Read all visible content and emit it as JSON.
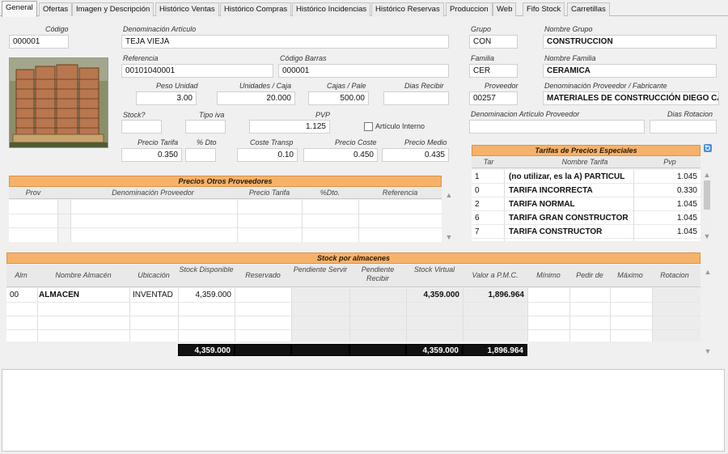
{
  "tabs": [
    "General",
    "Ofertas",
    "Imagen y Descripción",
    "Histórico Ventas",
    "Histórico Compras",
    "Histórico Incidencias",
    "Histórico Reservas",
    "Produccion",
    "Web",
    "Fifo Stock",
    "Carretillas"
  ],
  "fields": {
    "codigo": {
      "label": "Código",
      "value": "000001"
    },
    "denominacion": {
      "label": "Denominación Artículo",
      "value": "TEJA VIEJA"
    },
    "referencia": {
      "label": "Referencia",
      "value": "00101040001"
    },
    "codigo_barras": {
      "label": "Código Barras",
      "value": "000001"
    },
    "peso_unidad": {
      "label": "Peso Unidad",
      "value": "3.00"
    },
    "unidades_caja": {
      "label": "Unidades / Caja",
      "value": "20.000"
    },
    "cajas_pale": {
      "label": "Cajas / Pale",
      "value": "500.00"
    },
    "dias_recibir": {
      "label": "Dias Recibir",
      "value": ""
    },
    "stock": {
      "label": "Stock?",
      "value": ""
    },
    "tipo_iva": {
      "label": "Tipo iva",
      "value": ""
    },
    "pvp": {
      "label": "PVP",
      "value": "1.125"
    },
    "articulo_interno": {
      "label": "Artículo Interno"
    },
    "precio_tarifa": {
      "label": "Precio Tarifa",
      "value": "0.350"
    },
    "dto": {
      "label": "% Dto",
      "value": ""
    },
    "coste_transp": {
      "label": "Coste Transp",
      "value": "0.10"
    },
    "precio_coste": {
      "label": "Precio Coste",
      "value": "0.450"
    },
    "precio_medio": {
      "label": "Precio Medio",
      "value": "0.435"
    },
    "grupo": {
      "label": "Grupo",
      "value": "CON"
    },
    "nombre_grupo": {
      "label": "Nombre Grupo",
      "value": "CONSTRUCCION"
    },
    "familia": {
      "label": "Familia",
      "value": "CER"
    },
    "nombre_familia": {
      "label": "Nombre Familia",
      "value": "CERAMICA"
    },
    "proveedor": {
      "label": "Proveedor",
      "value": "00257"
    },
    "denom_proveedor": {
      "label": "Denominación Proveedor / Fabricante",
      "value": "MATERIALES DE CONSTRUCCIÓN DIEGO CA"
    },
    "denom_articulo_proveedor": {
      "label": "Denominacion Artículo Proveedor",
      "value": ""
    },
    "dias_rotacion": {
      "label": "Dias Rotacion",
      "value": ""
    }
  },
  "otros_proveedores": {
    "title": "Precios Otros Proveedores",
    "columns": [
      "Prov",
      "Denominación Proveedor",
      "Precio Tarifa",
      "%Dto.",
      "Referencia"
    ]
  },
  "tarifas": {
    "title": "Tarifas de Precios Especiales",
    "columns": [
      "Tar",
      "Nombre Tarifa",
      "Pvp"
    ],
    "rows": [
      {
        "tar": "1",
        "nombre": "(no utilizar, es la A) PARTICUL",
        "pvp": "1.045"
      },
      {
        "tar": "0",
        "nombre": "TARIFA INCORRECTA",
        "pvp": "0.330"
      },
      {
        "tar": "2",
        "nombre": "TARIFA NORMAL",
        "pvp": "1.045"
      },
      {
        "tar": "6",
        "nombre": "TARIFA GRAN CONSTRUCTOR",
        "pvp": "1.045"
      },
      {
        "tar": "7",
        "nombre": "TARIFA CONSTRUCTOR",
        "pvp": "1.045"
      }
    ]
  },
  "stock": {
    "title": "Stock por almacenes",
    "columns": [
      "Alm",
      "Nombre Almacén",
      "Ubicación",
      "Stock Disponible",
      "Reservado",
      "Pendiente Servir",
      "Pendiente Recibir",
      "Stock Virtual",
      "Valor a P.M.C.",
      "Mínimo",
      "Pedir de",
      "Máximo",
      "Rotacion"
    ],
    "rows": [
      {
        "alm": "00",
        "nombre": "ALMACEN",
        "ubicacion": "INVENTAD",
        "disponible": "4,359.000",
        "virtual": "4,359.000",
        "valor": "1,896.964"
      }
    ],
    "totals": {
      "disponible": "4,359.000",
      "virtual": "4,359.000",
      "valor": "1,896.964"
    }
  },
  "colors": {
    "accent": "#f6b26b",
    "total_bg": "#111111"
  }
}
